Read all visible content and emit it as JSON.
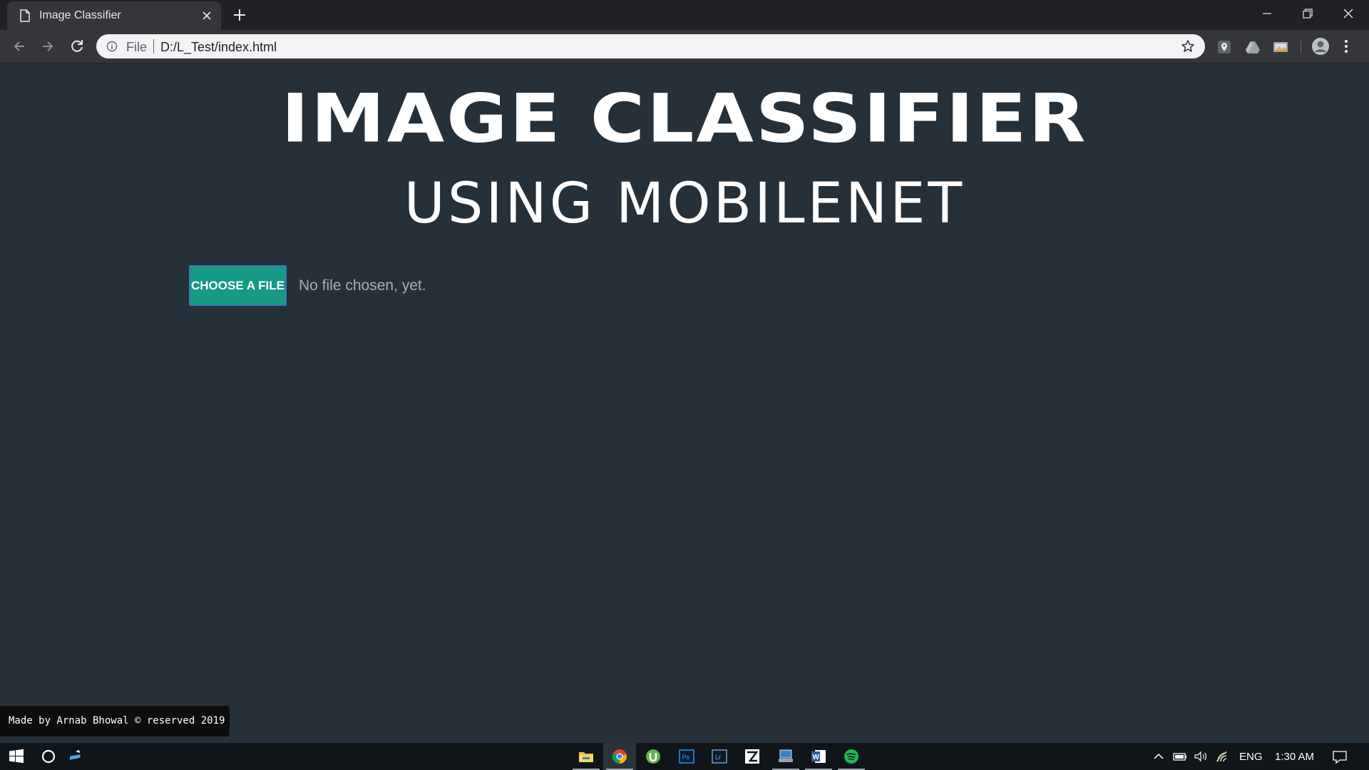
{
  "browser": {
    "tab_title": "Image Classifier",
    "omnibox": {
      "scheme_label": "File",
      "url": "D:/L_Test/index.html"
    }
  },
  "page": {
    "title": "IMAGE CLASSIFIER",
    "subtitle": "USING MOBILENET",
    "choose_button_label": "CHOOSE A FILE",
    "file_status": "No file chosen, yet.",
    "footer_text": "Made by Arnab Bhowal © reserved 2019"
  },
  "colors": {
    "page_background": "#263038",
    "button_background": "#159a84",
    "button_border": "#3b7ab8",
    "footer_background": "#0d0d0d"
  },
  "taskbar": {
    "apps": [
      "file-explorer-icon",
      "chrome-icon",
      "utorrent-icon",
      "photoshop-icon",
      "lightroom-icon",
      "zapp-icon",
      "network-app-icon",
      "word-icon",
      "spotify-icon"
    ],
    "tray": {
      "language": "ENG",
      "time": "1:30 AM"
    }
  }
}
